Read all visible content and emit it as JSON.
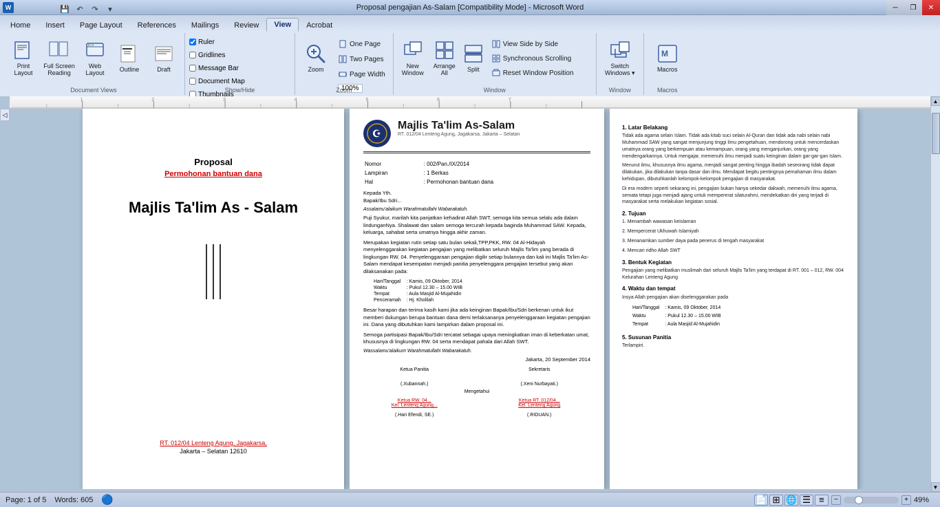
{
  "window": {
    "title": "Proposal pengajian As-Salam [Compatibility Mode] - Microsoft Word",
    "controls": [
      "minimize",
      "restore",
      "close"
    ]
  },
  "ribbon": {
    "tabs": [
      "Home",
      "Insert",
      "Page Layout",
      "References",
      "Mailings",
      "Review",
      "View",
      "Acrobat"
    ],
    "active_tab": "View",
    "groups": {
      "document_views": {
        "label": "Document Views",
        "buttons": [
          "Print Layout",
          "Full Screen Reading",
          "Web Layout",
          "Outline",
          "Draft"
        ]
      },
      "show_hide": {
        "label": "Show/Hide",
        "checkboxes": [
          "Ruler",
          "Gridlines",
          "Message Bar",
          "Document Map",
          "Thumbnails"
        ]
      },
      "zoom": {
        "label": "Zoom",
        "zoom_btn": "Zoom",
        "zoom_value": "100%",
        "one_page": "One Page",
        "two_pages": "Two Pages",
        "page_width": "Page Width"
      },
      "window": {
        "label": "Window",
        "new_window": "New Window",
        "arrange_all": "Arrange All",
        "split": "Split",
        "view_side_by_side": "View Side by Side",
        "synchronous_scrolling": "Synchronous Scrolling",
        "reset_window_position": "Reset Window Position",
        "switch_windows": "Switch Windows"
      },
      "macros": {
        "label": "Macros",
        "macros": "Macros"
      }
    }
  },
  "status_bar": {
    "page_info": "Page: 1 of 5",
    "words": "Words: 605",
    "zoom": "49%"
  },
  "document": {
    "page1": {
      "title": "Proposal",
      "subtitle": "Permohonan bantuan dana",
      "org_name": "Majlis Ta'lim As - Salam",
      "address": "RT. 012/04 Lenteng Agung, Jagakarsa,",
      "city": "Jakarta – Selatan 12610"
    },
    "page2": {
      "org_name": "Majlis Ta'lim  As-Salam",
      "org_tagline": "RT. 012/04 Lenteng Agung, Jagakarsa, Jakarta – Selatan",
      "nomor_label": "Nomor",
      "nomor_value": ": 002/Pan./IX/2014",
      "lampiran_label": "Lampiran",
      "lampiran_value": ": 1 Berkas",
      "hal_label": "Hal",
      "hal_value": ": Permohonan bantuan dana",
      "kepada": "Kepada Yth.",
      "bapak": "Bapak/Ibu Sdri...",
      "salam_open": "Assalamu'alaikum Warahmatullahi Wabarakatuh.",
      "body1": "Puji Syukur, marilah kita panjatkan kehadirat Allah SWT, semoga kita semua selalu ada dalam lindunganNya. Shalawat dan salam semoga tercurah kepada baginda Muhammad SAW. Kepada, keluarga, sahabat serta umatnya hingga akhir zaman.",
      "body2": "Merupakan kegiatan rutin setiap satu bulan sekali,TPP,PKK, RW. 04 Al-Hidayah menyelenggarakan kegiatan pengajian yang melibatkan seluruh Majlis Ta'lim yang berada di lingkungan RW. 04. Penyelenggaraan pengajian digilir setiap bulannya dan kali ini Majlis Ta'lim As-Salam mendapat kesempatan menjadi panitia penyelenggara pengajian tersebut yang akan dilaksanakan pada:",
      "hari_label": "Hari/Tanggal",
      "hari_value": ": Kamis, 09 Oktober, 2014",
      "waktu_label": "Waktu",
      "waktu_value": ": Pukul 12.30 – 15.00 WIB",
      "tempat_label": "Tempat",
      "tempat_value": ": Aula Masjid Al-Mujahidin",
      "penceramah_label": "Penceramah",
      "penceramah_value": ": Hj. Kholilah",
      "body3": "Besar harapan dan terima kasih kami jika ada keinginan Bapak/Ibu/Sdri berkenan untuk ikut memberi dukungan berupa bantuan dana demi terlaksananya penyelenggaraan kegiatan pengajian ini. Dana yang dibutuhkan kami lampirkan dalam proposal ini.",
      "body4": "Semoga partisipasi Bapak/Ibu/Sdri tercatat sebagai upaya meningkatkan iman di keberkatan umat, khususnya di lingkungan RW. 04 serta mendapat pahala dari Allah SWT.",
      "salam_close": "Wassalamu'alaikum Warahmatullahi Wabarakatuh.",
      "jakarta_date": "Jakarta, 20 September 2014",
      "ketua_label": "Ketua Panitia",
      "sekretaris_label": "Sekretaris",
      "ketua_mengetahui": "Mengetahui",
      "xubannah": "(.Xubannah.)",
      "xeni": "(.Xeni Nurbayati.)",
      "ketua_rw": "Ketua RW. 04...",
      "ketua_rw2": "Ketua RT. 012/04...",
      "kel_lenteng": "Kel. Lenteng Agung...",
      "kel_lenteng2": "Kel. Lenteng Agung",
      "hari_efendi": "(.Hari Efendi, SE.)",
      "riduan": "(.RIDUAN.)"
    },
    "page3": {
      "section1_num": "1.",
      "section1_title": "Latar Belakang",
      "section1_text": "Tidak ada agama selain Islam. Tidak ada kitab suci selain Al-Quran dan tidak ada nabi selain nabi Muhammad SAW yang sangat menjunjung tinggi ilmu pengetahuan, mendorong untuk mencerdaskan umatnya orang yang berkempuan atau kemampuan, orang yang menganjurkan, orang yang mendengarkannya. Untuk mengajar, memenuhi ilmu menjadi suatu keinginan dalam gar-gar-gan Islam.",
      "section1_text2": "Menurut ilmu, khususnya ilmu agama, menjadi sangat penting hingga ibadah seseorang tidak dapat dilakukan, jika dilakukan tanpa dasar dan ilmu. Mendapat begitu pentingnya pemahaman ilmu dalam kehidupan, dibutuhkanlah kelompok-kelompok pengajian di masyarakat.",
      "section1_text3": "Di era modern seperti sekarang ini, pengajian bukan hanya sekedar dakwah, memenuhi ilmu agama, semata tetapi juga menjadi ajang untuk mempererat silaturahmi, mendekatkan diri yang terjadi di masyarakat serta melakukan kegiatan sosial.",
      "section2_num": "2.",
      "section2_title": "Tujuan",
      "goal1": "1.   Menambah wawasan keislaman",
      "goal2": "2.   Mempercerat Ukhuwah Islamiyah",
      "goal3": "3.   Menanamkan sumber daya pada penerus di tengah masyarakat",
      "goal4": "4.   Mencari ridho Allah SWT",
      "section3_num": "3.",
      "section3_title": "Bentuk Kegiatan",
      "section3_text": "Pengajian yang melibatkan muslimah dari seluruh Majlis Ta'lim yang terdapat di RT. 001 – 012, RW. 004 Kelurahan Lenteng Agung",
      "section4_num": "4.",
      "section4_title": "Waktu dan tempat",
      "section4_intro": "Insya Allah pengajian akan diselenggarakan pada",
      "event_hari": "Hari/Tanggal",
      "event_hari_val": ": Kamis, 09 Oktober, 2014",
      "event_waktu": "Waktu",
      "event_waktu_val": ": Pukul 12.30 – 15.00 WIB",
      "event_tempat": "Tempat",
      "event_tempat_val": ": Aula Masjid Al-Mujahidin",
      "section5_num": "5.",
      "section5_title": "Susunan Panitia",
      "section5_text": "Terlampiri."
    }
  }
}
